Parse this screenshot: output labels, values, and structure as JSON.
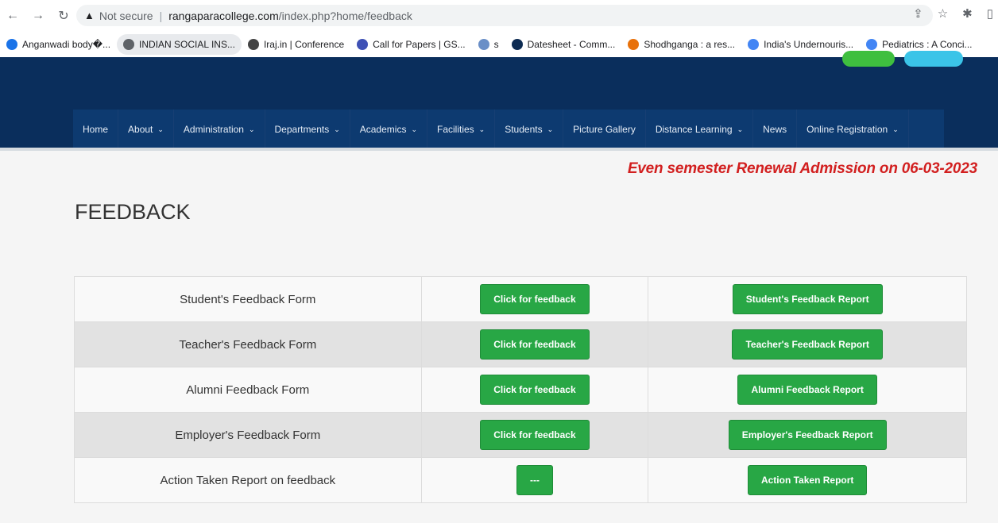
{
  "browser": {
    "security_label": "Not secure",
    "url_host": "rangaparacollege.com",
    "url_path": "/index.php?home/feedback"
  },
  "bookmarks": [
    {
      "label": "Anganwadi body�...",
      "color": "#1a73e8"
    },
    {
      "label": "INDIAN SOCIAL INS...",
      "color": "#5f6368"
    },
    {
      "label": "Iraj.in | Conference",
      "color": "#444"
    },
    {
      "label": "Call for Papers | GS...",
      "color": "#3f51b5"
    },
    {
      "label": "s",
      "color": "#6a8fc7"
    },
    {
      "label": "Datesheet - Comm...",
      "color": "#0d2b52"
    },
    {
      "label": "Shodhganga : a res...",
      "color": "#e8710a"
    },
    {
      "label": "India's Undernouris...",
      "color": "#4285f4"
    },
    {
      "label": "Pediatrics : A Conci...",
      "color": "#4285f4"
    }
  ],
  "menu": [
    {
      "label": "Home",
      "dropdown": false
    },
    {
      "label": "About",
      "dropdown": true
    },
    {
      "label": "Administration",
      "dropdown": true
    },
    {
      "label": "Departments",
      "dropdown": true
    },
    {
      "label": "Academics",
      "dropdown": true
    },
    {
      "label": "Facilities",
      "dropdown": true
    },
    {
      "label": "Students",
      "dropdown": true
    },
    {
      "label": "Picture Gallery",
      "dropdown": false
    },
    {
      "label": "Distance Learning",
      "dropdown": true
    },
    {
      "label": "News",
      "dropdown": false
    },
    {
      "label": "Online Registration",
      "dropdown": true
    }
  ],
  "ticker": "Even semester Renewal Admission on 06-03-2023",
  "page_title": "FEEDBACK",
  "rows": [
    {
      "form": "Student's Feedback Form",
      "action": "Click for feedback",
      "report": "Student's Feedback Report"
    },
    {
      "form": "Teacher's Feedback Form",
      "action": "Click for feedback",
      "report": "Teacher's Feedback Report"
    },
    {
      "form": "Alumni Feedback Form",
      "action": "Click for feedback",
      "report": "Alumni Feedback Report"
    },
    {
      "form": "Employer's Feedback Form",
      "action": "Click for feedback",
      "report": "Employer's Feedback Report"
    },
    {
      "form": "Action Taken Report on feedback",
      "action": "---",
      "report": "Action Taken Report"
    }
  ],
  "colors": {
    "header": "#0a2e5c",
    "button": "#28a745",
    "ticker": "#d21f1f"
  }
}
